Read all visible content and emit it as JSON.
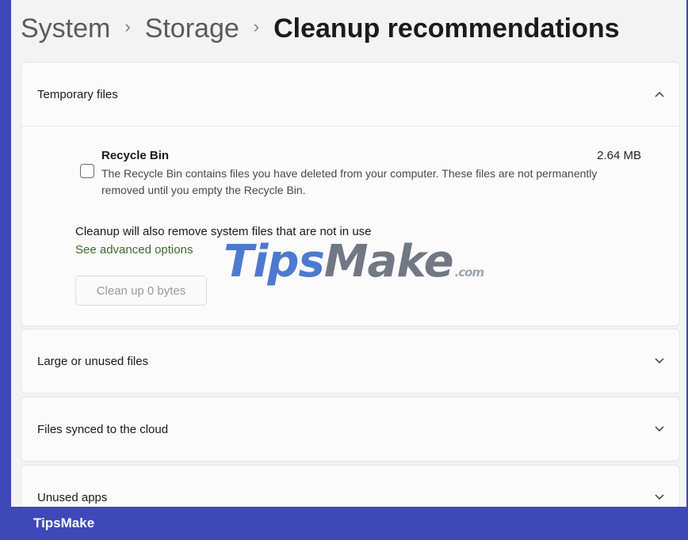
{
  "breadcrumb": {
    "items": [
      "System",
      "Storage"
    ],
    "current": "Cleanup recommendations",
    "separator": "›"
  },
  "sections": [
    {
      "title": "Temporary files",
      "expanded": true
    },
    {
      "title": "Large or unused files",
      "expanded": false
    },
    {
      "title": "Files synced to the cloud",
      "expanded": false
    },
    {
      "title": "Unused apps",
      "expanded": false
    }
  ],
  "recycle_bin": {
    "title": "Recycle Bin",
    "size": "2.64 MB",
    "checked": false,
    "description": "The Recycle Bin contains files you have deleted from your computer. These files are not permanently removed until you empty the Recycle Bin."
  },
  "cleanup_note": "Cleanup will also remove system files that are not in use",
  "advanced_link": "See advanced options",
  "clean_button": "Clean up 0 bytes",
  "watermark": {
    "part1": "Tips",
    "part2": "Make",
    "suffix": ".com"
  },
  "footer_brand": "TipsMake",
  "colors": {
    "background": "#f3f3f3",
    "frame_border": "#3f48b8",
    "link": "#3e6b2e"
  }
}
